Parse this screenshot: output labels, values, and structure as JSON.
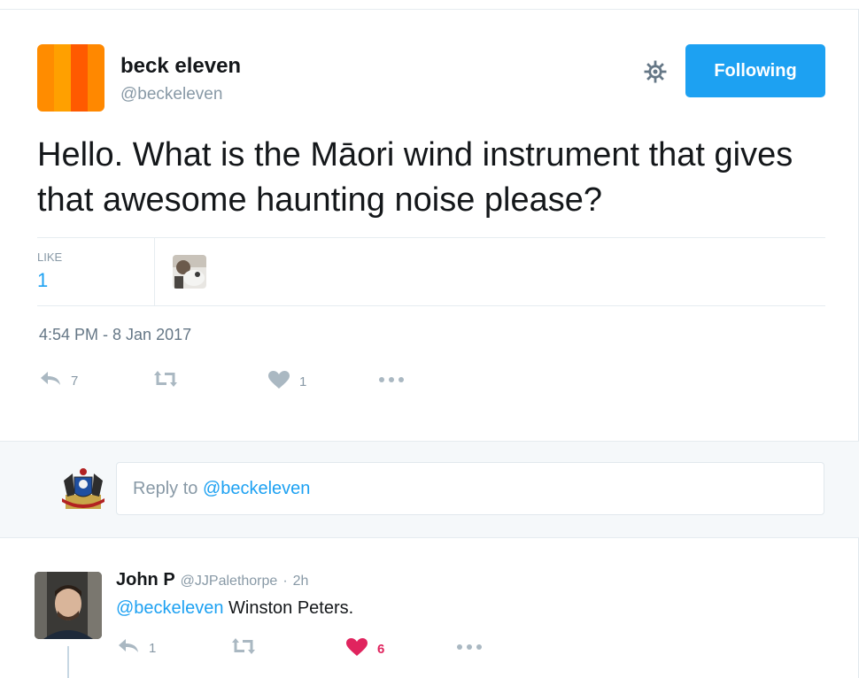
{
  "tweet": {
    "author_name": "beck eleven",
    "author_handle": "@beckeleven",
    "follow_label": "Following",
    "text": "Hello. What is the Māori wind instrument that gives that awesome haunting noise please?",
    "stats": {
      "like_label": "LIKE",
      "like_count": "1"
    },
    "timestamp": "4:54 PM - 8 Jan 2017",
    "actions": {
      "reply_count": "7",
      "retweet_count": "",
      "like_count": "1"
    }
  },
  "reply_box": {
    "prefix": "Reply to ",
    "mention": "@beckeleven"
  },
  "reply": {
    "author_name": "John P",
    "author_handle": "@JJPalethorpe",
    "separator": "·",
    "time": "2h",
    "mention": "@beckeleven",
    "text": " Winston Peters.",
    "actions": {
      "reply_count": "1",
      "retweet_count": "",
      "like_count": "6"
    }
  },
  "colors": {
    "accent": "#1da1f2",
    "liked": "#e0245e",
    "icon_gray": "#aab8c2",
    "avatar_stripes": [
      "#ff7f00",
      "#ff9500",
      "#ff4d00",
      "#ff7f00"
    ]
  },
  "icons": {
    "settings": "gear-icon",
    "reply": "reply-icon",
    "retweet": "retweet-icon",
    "like": "heart-icon",
    "more": "more-icon"
  }
}
